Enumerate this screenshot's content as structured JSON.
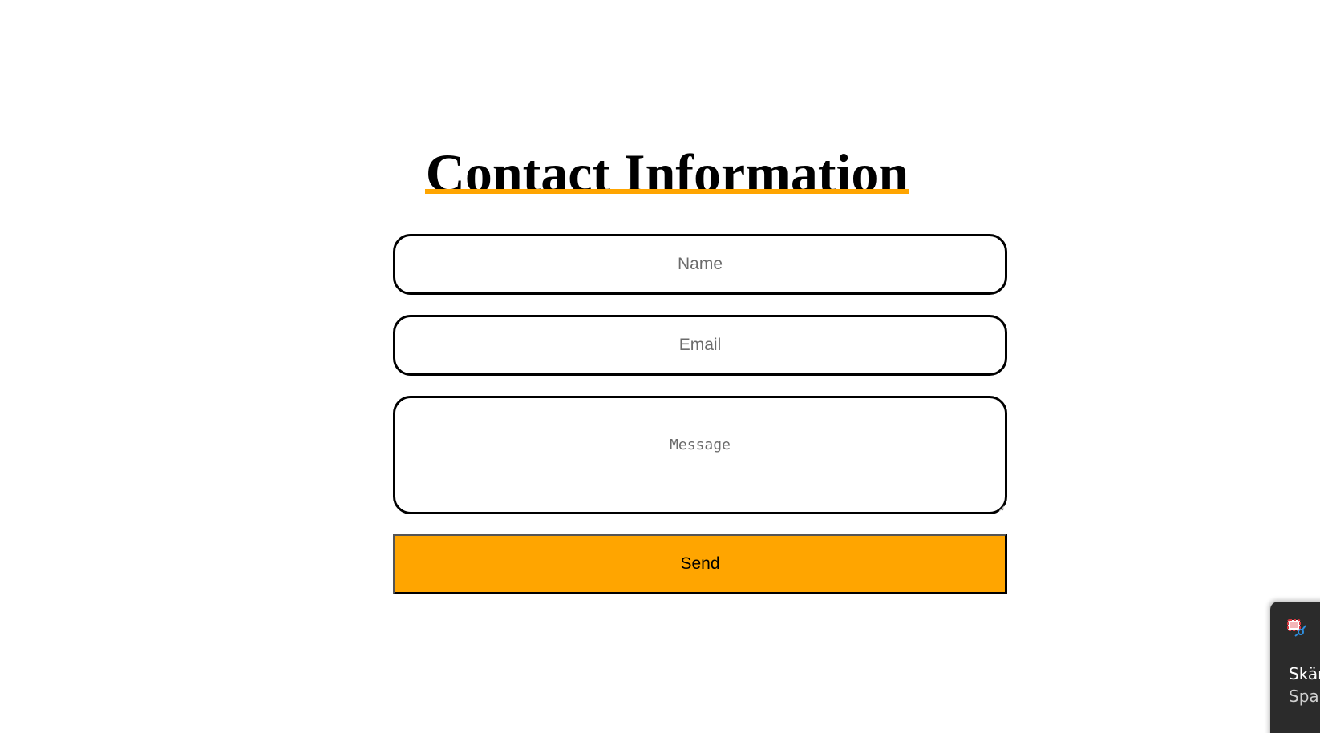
{
  "page": {
    "title": "Contact Information",
    "accent_color": "#ffa500"
  },
  "form": {
    "name_placeholder": "Name",
    "email_placeholder": "Email",
    "message_placeholder": "Message",
    "send_label": "Send"
  },
  "notification": {
    "icon": "snipping-tool-icon",
    "title": "Skär",
    "subtitle": "Spar"
  }
}
